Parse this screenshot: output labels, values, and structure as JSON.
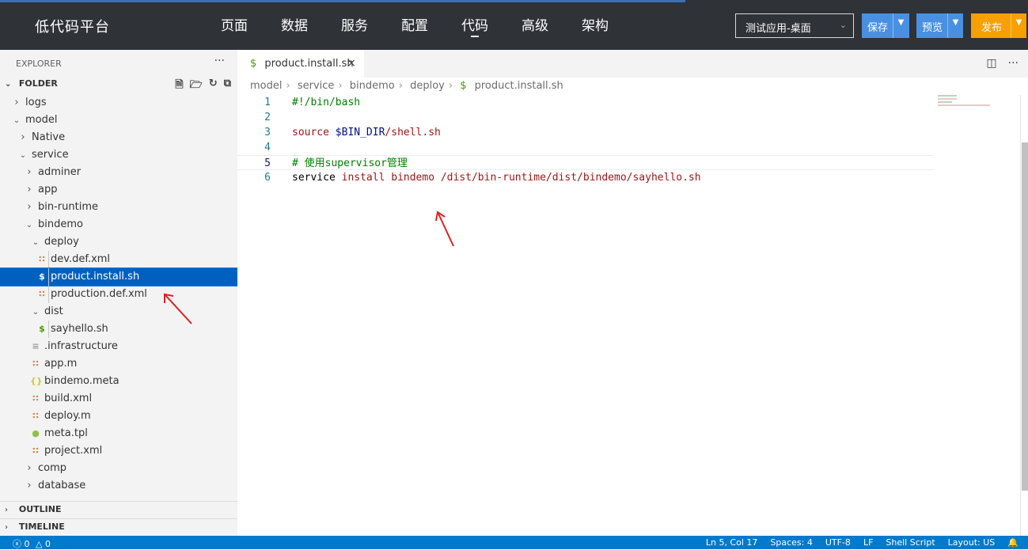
{
  "topbar": {
    "brand": "低代码平台",
    "nav": [
      "页面",
      "数据",
      "服务",
      "配置",
      "代码",
      "高级",
      "架构"
    ],
    "active_nav": "代码",
    "app_select": "测试应用-桌面",
    "save_label": "保存",
    "preview_label": "预览",
    "publish_label": "发布"
  },
  "sidebar": {
    "title": "EXPLORER",
    "folder": "FOLDER",
    "tree": [
      {
        "label": "logs",
        "depth": 1,
        "type": "folder",
        "open": false
      },
      {
        "label": "model",
        "depth": 1,
        "type": "folder",
        "open": true
      },
      {
        "label": "Native",
        "depth": 2,
        "type": "folder",
        "open": false
      },
      {
        "label": "service",
        "depth": 2,
        "type": "folder",
        "open": true
      },
      {
        "label": "adminer",
        "depth": 3,
        "type": "folder",
        "open": false
      },
      {
        "label": "app",
        "depth": 3,
        "type": "folder",
        "open": false
      },
      {
        "label": "bin-runtime",
        "depth": 3,
        "type": "folder",
        "open": false
      },
      {
        "label": "bindemo",
        "depth": 3,
        "type": "folder",
        "open": true
      },
      {
        "label": "deploy",
        "depth": 4,
        "type": "folder",
        "open": true
      },
      {
        "label": "dev.def.xml",
        "depth": 5,
        "type": "xml"
      },
      {
        "label": "product.install.sh",
        "depth": 5,
        "type": "sh",
        "selected": true
      },
      {
        "label": "production.def.xml",
        "depth": 5,
        "type": "xml"
      },
      {
        "label": "dist",
        "depth": 4,
        "type": "folder",
        "open": true
      },
      {
        "label": "sayhello.sh",
        "depth": 5,
        "type": "sh"
      },
      {
        "label": ".infrastructure",
        "depth": 4,
        "type": "text"
      },
      {
        "label": "app.m",
        "depth": 4,
        "type": "xml"
      },
      {
        "label": "bindemo.meta",
        "depth": 4,
        "type": "json"
      },
      {
        "label": "build.xml",
        "depth": 4,
        "type": "xml"
      },
      {
        "label": "deploy.m",
        "depth": 4,
        "type": "xml"
      },
      {
        "label": "meta.tpl",
        "depth": 4,
        "type": "tpl"
      },
      {
        "label": "project.xml",
        "depth": 4,
        "type": "xml"
      },
      {
        "label": "comp",
        "depth": 3,
        "type": "folder",
        "open": false
      },
      {
        "label": "database",
        "depth": 3,
        "type": "folder",
        "open": false
      }
    ],
    "outline": "OUTLINE",
    "timeline": "TIMELINE"
  },
  "editor": {
    "tab": "product.install.sh",
    "breadcrumb": [
      "model",
      "service",
      "bindemo",
      "deploy"
    ],
    "breadcrumb_file": "product.install.sh",
    "lines": [
      {
        "n": "1",
        "parts": [
          {
            "t": "#!/bin/bash",
            "c": "comment"
          }
        ]
      },
      {
        "n": "2",
        "parts": []
      },
      {
        "n": "3",
        "parts": [
          {
            "t": "source ",
            "c": "str"
          },
          {
            "t": "$BIN_DIR",
            "c": "var"
          },
          {
            "t": "/shell.sh",
            "c": "str"
          }
        ]
      },
      {
        "n": "4",
        "parts": []
      },
      {
        "n": "5",
        "parts": [
          {
            "t": "# 使用supervisor管理",
            "c": "comment"
          }
        ],
        "current": true
      },
      {
        "n": "6",
        "parts": [
          {
            "t": "service ",
            "c": "cmd"
          },
          {
            "t": "install bindemo /dist/bin-runtime/dist/bindemo/sayhello.sh",
            "c": "str"
          }
        ]
      }
    ]
  },
  "status": {
    "errors": "0",
    "warnings": "0",
    "position": "Ln 5, Col 17",
    "spaces": "Spaces: 4",
    "encoding": "UTF-8",
    "eol": "LF",
    "language": "Shell Script",
    "layout": "Layout: US"
  },
  "colors": {
    "topbar": "#2f3237",
    "accent_blue": "#4a90e2",
    "publish_orange": "#f7a000",
    "status_blue": "#007acc",
    "selection": "#0060c0",
    "annotation_red": "#e02020"
  }
}
